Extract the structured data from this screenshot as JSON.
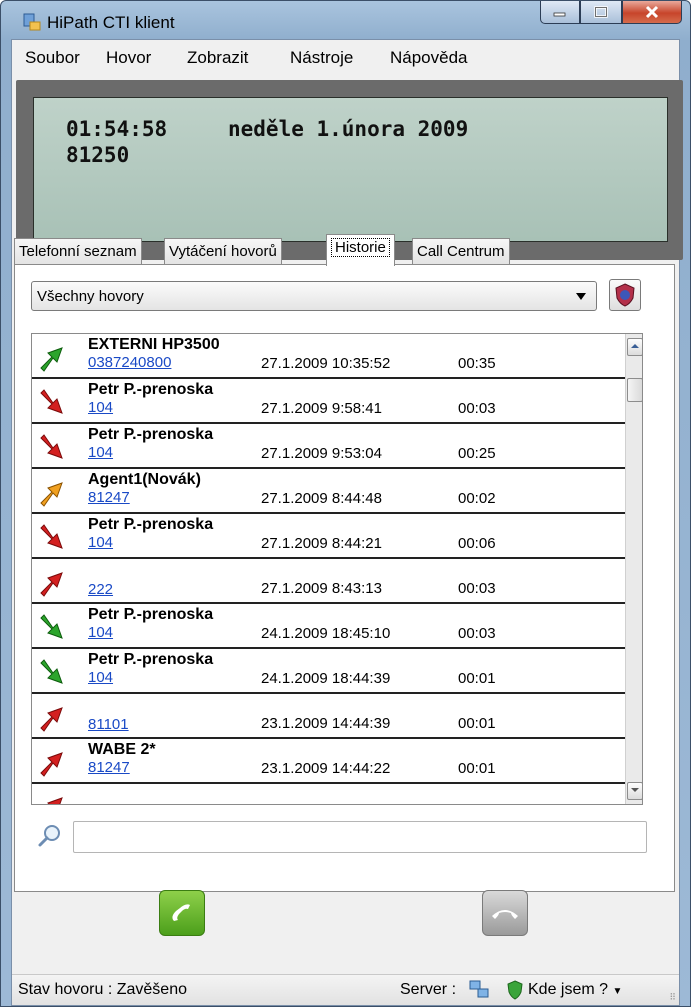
{
  "window": {
    "title": "HiPath CTI klient"
  },
  "menu": [
    "Soubor",
    "Hovor",
    "Zobrazit",
    "Nástroje",
    "Nápověda"
  ],
  "display": {
    "time": "01:54:58",
    "date": "neděle 1.února 2009",
    "extension": "81250"
  },
  "tabs": [
    {
      "label": "Telefonní seznam"
    },
    {
      "label": "Vytáčení hovorů"
    },
    {
      "label": "Historie"
    },
    {
      "label": "Call Centrum"
    }
  ],
  "filter": {
    "selected": "Všechny hovory"
  },
  "history": [
    {
      "name": "EXTERNI HP3500",
      "number": "0387240800",
      "datetime": "27.1.2009 10:35:52",
      "duration": "00:35",
      "icon": "outgoing-answered-green-icon"
    },
    {
      "name": "Petr P.-prenoska",
      "number": "104",
      "datetime": "27.1.2009 9:58:41",
      "duration": "00:03",
      "icon": "incoming-red-icon"
    },
    {
      "name": "Petr P.-prenoska",
      "number": "104",
      "datetime": "27.1.2009 9:53:04",
      "duration": "00:25",
      "icon": "incoming-red-icon"
    },
    {
      "name": "Agent1(Novák)",
      "number": "81247",
      "datetime": "27.1.2009 8:44:48",
      "duration": "00:02",
      "icon": "outgoing-orange-icon"
    },
    {
      "name": "Petr P.-prenoska",
      "number": "104",
      "datetime": "27.1.2009 8:44:21",
      "duration": "00:06",
      "icon": "incoming-red-icon"
    },
    {
      "name": "",
      "number": "222",
      "datetime": "27.1.2009 8:43:13",
      "duration": "00:03",
      "icon": "outgoing-red-icon"
    },
    {
      "name": "Petr P.-prenoska",
      "number": "104",
      "datetime": "24.1.2009 18:45:10",
      "duration": "00:03",
      "icon": "incoming-green-icon"
    },
    {
      "name": "Petr P.-prenoska",
      "number": "104",
      "datetime": "24.1.2009 18:44:39",
      "duration": "00:01",
      "icon": "incoming-green-icon"
    },
    {
      "name": "",
      "number": "81101",
      "datetime": "23.1.2009 14:44:39",
      "duration": "00:01",
      "icon": "outgoing-red-icon"
    },
    {
      "name": "WABE 2*",
      "number": "81247",
      "datetime": "23.1.2009 14:44:22",
      "duration": "00:01",
      "icon": "outgoing-red-icon"
    }
  ],
  "search": {
    "value": ""
  },
  "status": {
    "call_state": "Stav hovoru : Zavěšeno",
    "server_label": "Server :",
    "where_label": "Kde jsem ?"
  }
}
